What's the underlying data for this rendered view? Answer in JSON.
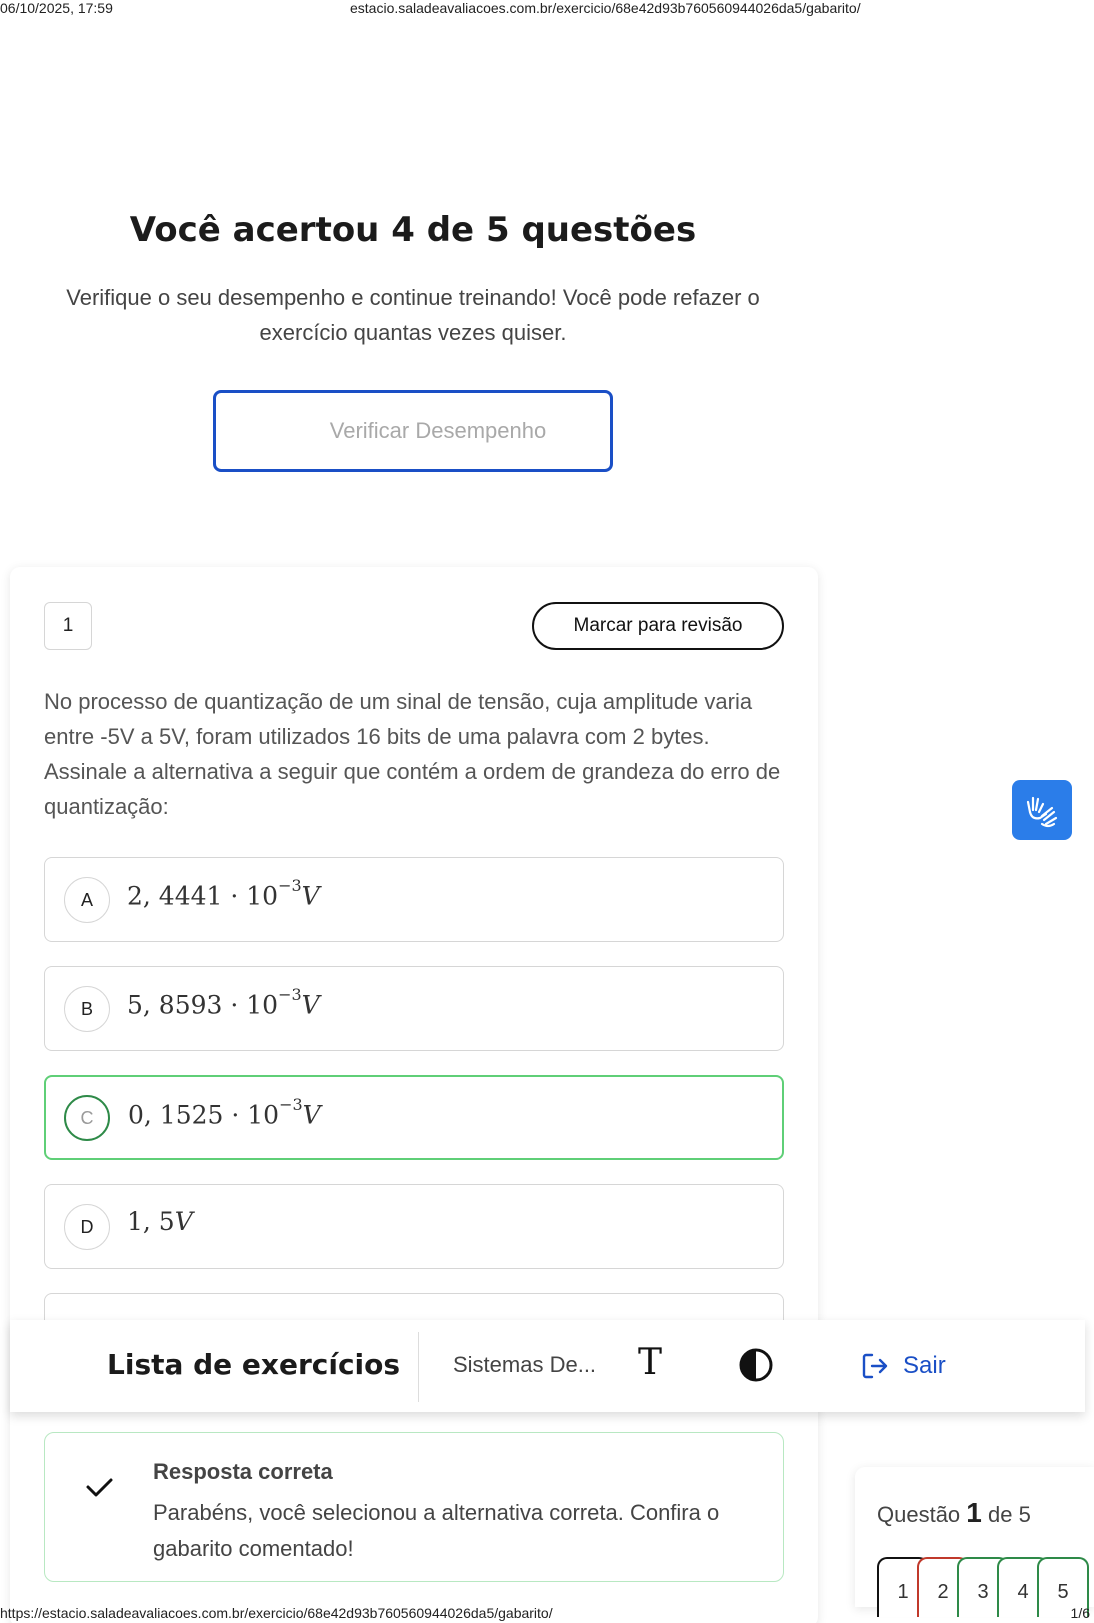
{
  "print": {
    "date": "06/10/2025, 17:59",
    "header_url": "estacio.saladeavaliacoes.com.br/exercicio/68e42d93b760560944026da5/gabarito/",
    "footer_url": "https://estacio.saladeavaliacoes.com.br/exercicio/68e42d93b760560944026da5/gabarito/",
    "page": "1/6"
  },
  "hero": {
    "title": "Você acertou 4 de 5 questões",
    "subtitle": "Verifique o seu desempenho e continue treinando! Você pode refazer o exercício quantas vezes quiser.",
    "verify_label": "Verificar Desempenho",
    "accent": "#1a4fc6"
  },
  "question": {
    "number": "1",
    "review_label": "Marcar para revisão",
    "statement": "No processo de quantização de um sinal de tensão, cuja amplitude varia entre -5V a 5V, foram utilizados 16 bits de uma palavra com 2 bytes. Assinale a alternativa a seguir que contém a ordem de grandeza do erro de quantização:",
    "options": [
      {
        "letter": "A",
        "mantissa": "2, 4441 · 10",
        "exp": "−3",
        "unit": "V",
        "correct": false
      },
      {
        "letter": "B",
        "mantissa": "5, 8593 · 10",
        "exp": "−3",
        "unit": "V",
        "correct": false
      },
      {
        "letter": "C",
        "mantissa": "0, 1525 · 10",
        "exp": "−3",
        "unit": "V",
        "correct": true
      },
      {
        "letter": "D",
        "mantissa": "1, 5",
        "exp": "",
        "unit": "V",
        "correct": false
      }
    ],
    "correct_color": "#5fcf77"
  },
  "feedback": {
    "title": "Resposta correta",
    "message": "Parabéns, você selecionou a alternativa correta. Confira o gabarito comentado!"
  },
  "toolbar": {
    "list_title": "Lista de exercícios",
    "subject": "Sistemas De...",
    "font_icon": "T",
    "exit_label": "Sair"
  },
  "nav": {
    "prefix": "Questão",
    "current": "1",
    "suffix": "de 5",
    "buttons": [
      "1",
      "2",
      "3",
      "4",
      "5"
    ]
  },
  "icons": {
    "accessibility": "sign-language-hands-icon",
    "contrast": "contrast-icon",
    "exit": "logout-icon",
    "check": "check-icon"
  }
}
